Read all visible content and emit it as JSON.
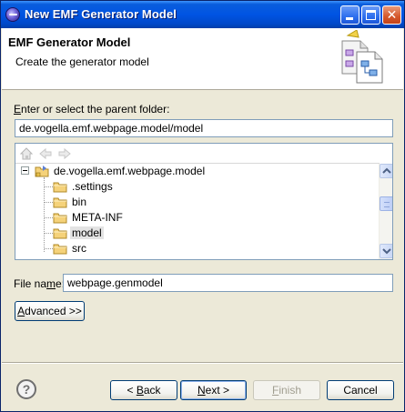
{
  "window": {
    "title": "New EMF Generator Model",
    "icon": "eclipse-icon"
  },
  "header": {
    "title": "EMF Generator Model",
    "description": "Create the generator model",
    "icon": "genmodel-wizard-icon"
  },
  "parent_folder": {
    "label_prefix": "",
    "label_mnemonic": "E",
    "label_rest": "nter or select the parent folder:",
    "value": "de.vogella.emf.webpage.model/model"
  },
  "tree": {
    "toolbar": [
      "home-icon",
      "back-icon",
      "forward-icon"
    ],
    "root": {
      "label": "de.vogella.emf.webpage.model",
      "icon": "project-folder-icon",
      "expanded": true
    },
    "children": [
      {
        "label": ".settings",
        "icon": "folder-icon",
        "selected": false
      },
      {
        "label": "bin",
        "icon": "folder-icon",
        "selected": false
      },
      {
        "label": "META-INF",
        "icon": "folder-icon",
        "selected": false
      },
      {
        "label": "model",
        "icon": "folder-icon",
        "selected": true
      },
      {
        "label": "src",
        "icon": "folder-icon",
        "selected": false
      }
    ]
  },
  "file_name": {
    "label_prefix": "File na",
    "label_mnemonic": "m",
    "label_rest": "e:",
    "value": "webpage.genmodel"
  },
  "advanced_button": {
    "mnemonic": "A",
    "rest": "dvanced >>"
  },
  "footer": {
    "help_icon": "help-icon",
    "back": {
      "prefix": "< ",
      "mnemonic": "B",
      "rest": "ack"
    },
    "next": {
      "prefix": "",
      "mnemonic": "N",
      "rest": "ext >"
    },
    "finish": {
      "prefix": "",
      "mnemonic": "F",
      "rest": "inish",
      "enabled": false
    },
    "cancel": {
      "label": "Cancel"
    }
  },
  "colors": {
    "titlebar": "#0054e3",
    "dialog_bg": "#ece9d8",
    "field_border": "#7f9db9",
    "selection": "#e3e3e3"
  }
}
